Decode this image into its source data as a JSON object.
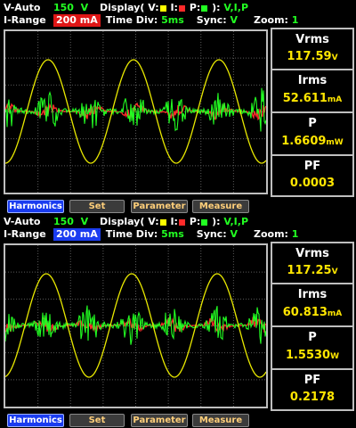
{
  "colors": {
    "voltage": "#ffff00",
    "current": "#ff2a2a",
    "power": "#22ff22",
    "range_red": "#e01616",
    "range_blue": "#1a3cf0"
  },
  "panels": [
    {
      "v_auto_label": "V-Auto",
      "v_value": "150",
      "v_unit": "V",
      "display_label": "Display( V:",
      "display_i": "I:",
      "display_p": "P:",
      "display_close": "):",
      "display_value": "V,I,P",
      "i_range_label": "I-Range",
      "i_range_value": "200 mA",
      "i_range_color": "red",
      "time_div_label": "Time Div:",
      "time_div_value": "5ms",
      "sync_label": "Sync:",
      "sync_value": "V",
      "zoom_label": "Zoom:",
      "zoom_value": "1",
      "measurements": [
        {
          "label": "Vrms",
          "value": "117.59",
          "unit": "V"
        },
        {
          "label": "Irms",
          "value": "52.611",
          "unit": "mA"
        },
        {
          "label": "P",
          "value": "1.6609",
          "unit": "mW"
        },
        {
          "label": "PF",
          "value": "0.0003",
          "unit": ""
        }
      ],
      "buttons": [
        "Harmonics",
        "Set",
        "Parameter",
        "Measure"
      ]
    },
    {
      "v_auto_label": "V-Auto",
      "v_value": "150",
      "v_unit": "V",
      "display_label": "Display( V:",
      "display_i": "I:",
      "display_p": "P:",
      "display_close": "):",
      "display_value": "V,I,P",
      "i_range_label": "I-Range",
      "i_range_value": "200 mA",
      "i_range_color": "blue",
      "time_div_label": "Time Div:",
      "time_div_value": "5ms",
      "sync_label": "Sync:",
      "sync_value": "V",
      "zoom_label": "Zoom:",
      "zoom_value": "1",
      "measurements": [
        {
          "label": "Vrms",
          "value": "117.25",
          "unit": "V"
        },
        {
          "label": "Irms",
          "value": "60.813",
          "unit": "mA"
        },
        {
          "label": "P",
          "value": "1.5530",
          "unit": "W"
        },
        {
          "label": "PF",
          "value": "0.2178",
          "unit": ""
        }
      ],
      "buttons": [
        "Harmonics",
        "Set",
        "Parameter",
        "Measure"
      ]
    }
  ]
}
